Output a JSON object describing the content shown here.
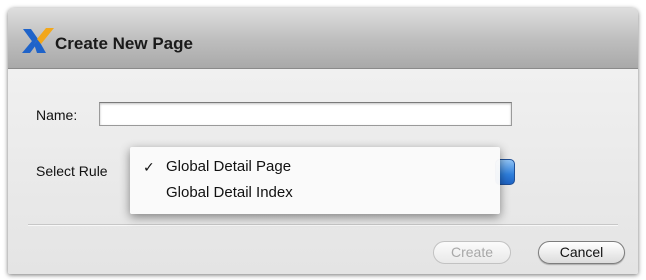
{
  "dialog": {
    "title": "Create New Page",
    "icon": "app-x-logo-icon",
    "accent_color": "#2f7fdb"
  },
  "form": {
    "name_label": "Name:",
    "name_value": "",
    "rule_label": "Select Rule"
  },
  "rule_menu": {
    "items": [
      {
        "label": "Global Detail Page",
        "checked": true,
        "check_glyph": "✓"
      },
      {
        "label": "Global Detail Index",
        "checked": false,
        "check_glyph": ""
      }
    ]
  },
  "buttons": {
    "create_label": "Create",
    "create_enabled": false,
    "cancel_label": "Cancel"
  }
}
